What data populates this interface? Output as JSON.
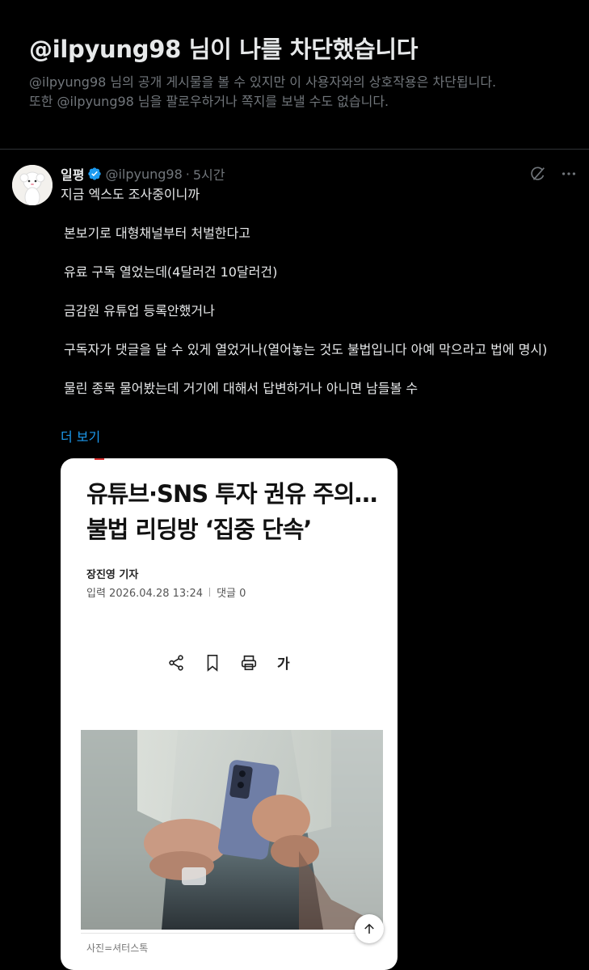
{
  "blocked": {
    "title": "@ilpyung98 님이 나를 차단했습니다",
    "desc_line1": "@ilpyung98 님의 공개 게시물을 볼 수 있지만 이 사용자와의 상호작용은 차단됩니다.",
    "desc_line2": "또한 @ilpyung98 님을 팔로우하거나 쪽지를 보낼 수도 없습니다."
  },
  "post": {
    "author": "일평",
    "handle": "@ilpyung98",
    "dot": "·",
    "time": "5시간",
    "lines": [
      "지금 엑스도 조사중이니까",
      "본보기로 대형채널부터 처벌한다고",
      "유료 구독 열었는데(4달러건 10달러건)",
      "금감원 유튜업 등록안했거나",
      "구독자가 댓글을 달 수 있게 열었거나(열어놓는 것도 불법입니다 아예 막으라고 법에 명시)",
      "물린 종목 물어봤는데 거기에 대해서 답변하거나 아니면 남들볼 수"
    ],
    "more": "더 보기"
  },
  "card": {
    "headline": "유튜브·SNS 투자 권유 주의…불법 리딩방 ‘집중 단속’",
    "reporter": "장진영 기자",
    "date": "입력 2026.04.28 13:24",
    "comments": "댓글 0",
    "font_size_label": "가",
    "caption": "사진=셔터스톡"
  },
  "icons": {
    "verified": "verified-badge-icon",
    "grok": "grok-icon",
    "more": "more-icon",
    "share": "share-icon",
    "bookmark": "bookmark-icon",
    "print": "print-icon",
    "scroll_top": "arrow-up-icon"
  },
  "colors": {
    "accent": "#1d9bf0",
    "background": "#000000",
    "muted": "#71767b"
  }
}
